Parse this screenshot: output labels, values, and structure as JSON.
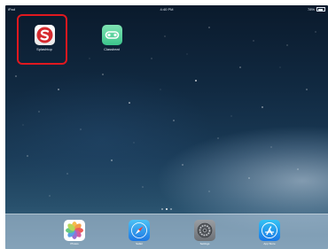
{
  "status_bar": {
    "device": "iPad",
    "time": "4:40 PM",
    "battery_text": "78%",
    "battery_level": 0.78
  },
  "home_apps": [
    {
      "label": "Splashtop",
      "icon": "splashtop-icon"
    },
    {
      "label": "Classbeat",
      "icon": "classbeat-icon"
    }
  ],
  "highlight": {
    "target": "Splashtop",
    "color": "#e0181f"
  },
  "page_indicator": {
    "pages": 3,
    "current": 2
  },
  "dock": [
    {
      "label": "Photos",
      "icon": "photos-icon"
    },
    {
      "label": "Safari",
      "icon": "safari-icon"
    },
    {
      "label": "Settings",
      "icon": "settings-icon"
    },
    {
      "label": "App Store",
      "icon": "app-store-icon"
    }
  ],
  "colors": {
    "splashtop_red": "#d62a2e",
    "classbeat_green": "#3cc58c",
    "highlight_red": "#e0181f"
  }
}
